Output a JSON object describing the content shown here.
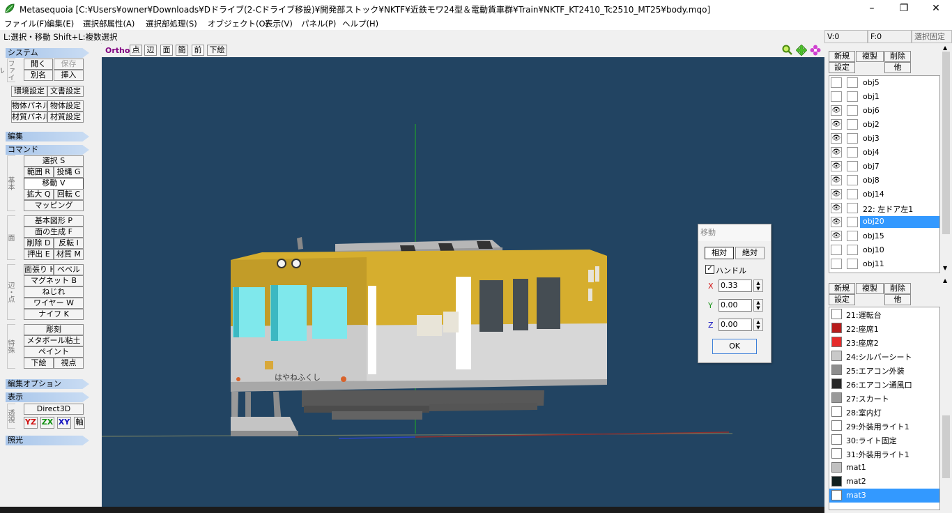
{
  "window": {
    "title": "Metasequoia [C:¥Users¥owner¥Downloads¥Dドライブ(2-Cドライブ移設)¥開発部ストック¥NKTF¥近鉄モワ24型＆電動貨車群¥Train¥NKTF_KT2410_Tc2510_MT25¥body.mqo]",
    "min": "–",
    "max": "❐",
    "close": "✕"
  },
  "menu": [
    "ファイル(F)",
    "編集(E)",
    "選択部属性(A)",
    "選択部処理(S)",
    "オブジェクト(O)",
    "表示(V)",
    "パネル(P)",
    "ヘルプ(H)"
  ],
  "status": {
    "hint": "L:選択・移動  Shift+L:複数選択",
    "v": "V:0",
    "f": "F:0",
    "lock": "選択固定"
  },
  "left": {
    "system": "システム",
    "file_group": "ファイル",
    "open": "開く",
    "save": "保存",
    "rename": "別名",
    "insert": "挿入",
    "env": "環境設定",
    "doc": "文書設定",
    "objpanel": "物体パネル",
    "objset": "物体設定",
    "matpanel": "材質パネル",
    "matset": "材質設定",
    "edit": "編集",
    "command": "コマンド",
    "basic_group": "基本",
    "select": "選択 S",
    "range": "範囲 R",
    "lasso": "投縄 G",
    "move": "移動 V",
    "scale": "拡大 Q",
    "rotate": "回転 C",
    "mapping": "マッピング",
    "face_group": "面",
    "prim": "基本図形 P",
    "facegen": "面の生成 F",
    "delete": "削除 D",
    "flip": "反転 I",
    "extrude": "押出 E",
    "material": "材質 M",
    "edge_group": "辺・点",
    "facestretch": "面張り H",
    "bevel": "ベベル",
    "magnet": "マグネット B",
    "twist": "ねじれ",
    "wire": "ワイヤー W",
    "knife": "ナイフ K",
    "special_group": "特殊",
    "sculpt": "彫刻",
    "metaball": "メタボール粘土",
    "paint": "ペイント",
    "under": "下絵",
    "viewpoint": "視点",
    "editopt": "編集オプション",
    "display": "表示",
    "persp_group": "透視",
    "direct3d": "Direct3D",
    "yz": "YZ",
    "zx": "ZX",
    "xy": "XY",
    "axis": "軸",
    "light": "照光"
  },
  "viewport": {
    "toolbar": [
      "Ortho",
      "点",
      "辺",
      "面",
      "簡",
      "前",
      "下絵"
    ],
    "colors": {
      "bg": "#224462",
      "yellow": "#d6ae2e",
      "silver": "#cfcfcf",
      "glass": "#7fe8ec"
    },
    "logo_text": "はやねふくし"
  },
  "right": {
    "obj_buttons": {
      "new": "新規",
      "dup": "複製",
      "del": "削除",
      "set": "設定",
      "other": "他"
    },
    "objects": [
      {
        "name": "obj5",
        "eye": false
      },
      {
        "name": "obj1",
        "eye": false
      },
      {
        "name": "obj6",
        "eye": true
      },
      {
        "name": "obj2",
        "eye": true
      },
      {
        "name": "obj3",
        "eye": true
      },
      {
        "name": "obj4",
        "eye": true
      },
      {
        "name": "obj7",
        "eye": true
      },
      {
        "name": "obj8",
        "eye": true
      },
      {
        "name": "obj14",
        "eye": true
      },
      {
        "name": "22: 左ドア左1",
        "eye": true
      },
      {
        "name": "obj20",
        "eye": true,
        "selected": true
      },
      {
        "name": "obj15",
        "eye": true
      },
      {
        "name": "obj10",
        "eye": false
      },
      {
        "name": "obj11",
        "eye": false
      }
    ],
    "mat_buttons": {
      "new": "新規",
      "dup": "複製",
      "del": "削除",
      "set": "設定",
      "other": "他"
    },
    "materials": [
      {
        "name": "21:運転台",
        "color": "#ffffff"
      },
      {
        "name": "22:座席1",
        "color": "#b81c1c"
      },
      {
        "name": "23:座席2",
        "color": "#e62b2b"
      },
      {
        "name": "24:シルバーシート",
        "color": "#c9c9c9"
      },
      {
        "name": "25:エアコン外装",
        "color": "#8e8e8e"
      },
      {
        "name": "26:エアコン通風口",
        "color": "#262626"
      },
      {
        "name": "27:スカート",
        "color": "#9a9a9a"
      },
      {
        "name": "28:室内灯",
        "color": "#ffffff"
      },
      {
        "name": "29:外装用ライト1",
        "color": "#ffffff"
      },
      {
        "name": "30:ライト固定",
        "color": "#ffffff"
      },
      {
        "name": "31:外装用ライト1",
        "color": "#ffffff"
      },
      {
        "name": "mat1",
        "color": "#c0c0c0"
      },
      {
        "name": "mat2",
        "color": "#102020"
      },
      {
        "name": "mat3",
        "color": "#ffffff",
        "selected": true
      }
    ]
  },
  "move_dialog": {
    "title": "移動",
    "relative": "相対",
    "absolute": "絶対",
    "handle": "ハンドル",
    "x_label": "X",
    "y_label": "Y",
    "z_label": "Z",
    "x": "0.33",
    "y": "0.00",
    "z": "0.00",
    "ok": "OK"
  }
}
